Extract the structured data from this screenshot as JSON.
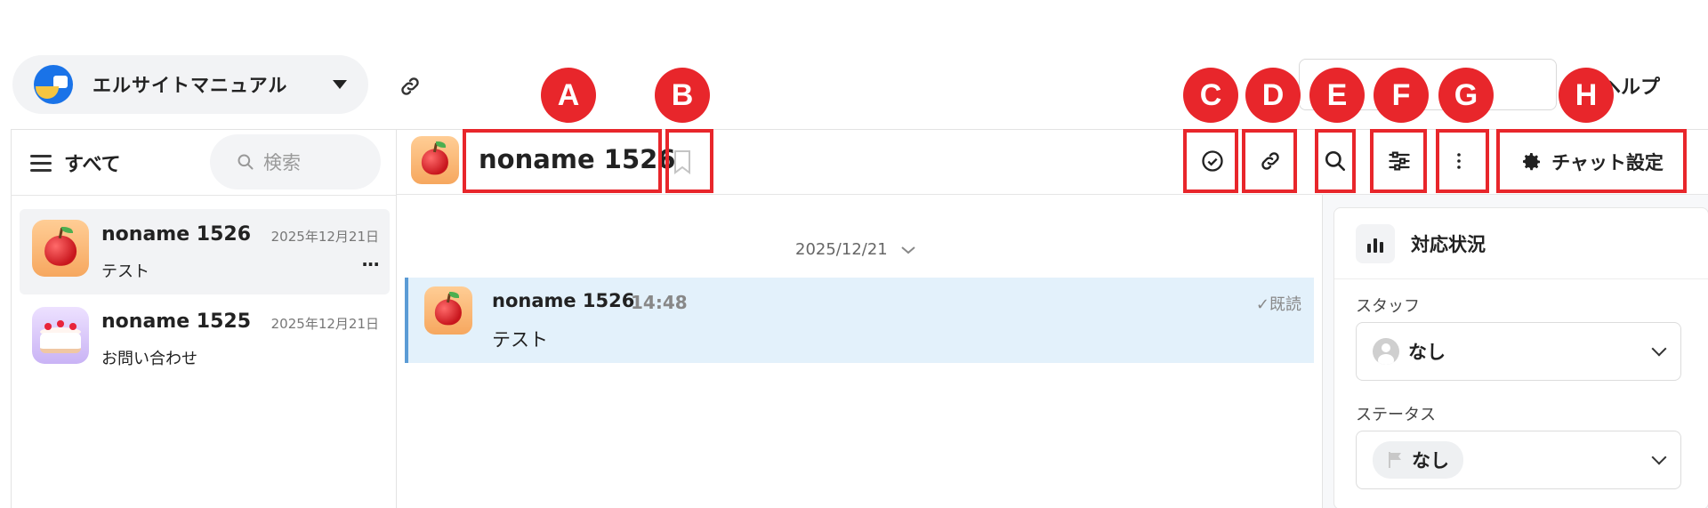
{
  "workspace": {
    "name": "エルサイトマニュアル"
  },
  "topbar": {
    "help_label": "ヘルプ"
  },
  "sidebar": {
    "filter_label": "すべて",
    "search_placeholder": "検索",
    "chats": [
      {
        "name": "noname 1526",
        "date": "2025年12月21日",
        "preview": "テスト",
        "more": "···",
        "avatar": "apple"
      },
      {
        "name": "noname 1525",
        "date": "2025年12月21日",
        "preview": "お問い合わせ",
        "avatar": "cake"
      }
    ]
  },
  "chat_header": {
    "title": "noname 1526",
    "settings_label": "チャット設定",
    "tools": [
      "check-circle-icon",
      "link-icon",
      "search-icon",
      "sliders-icon",
      "more-vertical-icon"
    ]
  },
  "messages": {
    "date_separator": "2025/12/21",
    "items": [
      {
        "sender": "noname 1526",
        "time": "14:48",
        "read_status": "既読",
        "text": "テスト"
      }
    ]
  },
  "status_panel": {
    "title": "対応状況",
    "staff_label": "スタッフ",
    "staff_value": "なし",
    "status_label": "ステータス",
    "status_value": "なし"
  },
  "annotations": [
    "A",
    "B",
    "C",
    "D",
    "E",
    "F",
    "G",
    "H"
  ],
  "colors": {
    "annotation": "#e8262b",
    "selected_message_bg": "#e3f1fb",
    "selected_message_border": "#5b9bd5"
  }
}
